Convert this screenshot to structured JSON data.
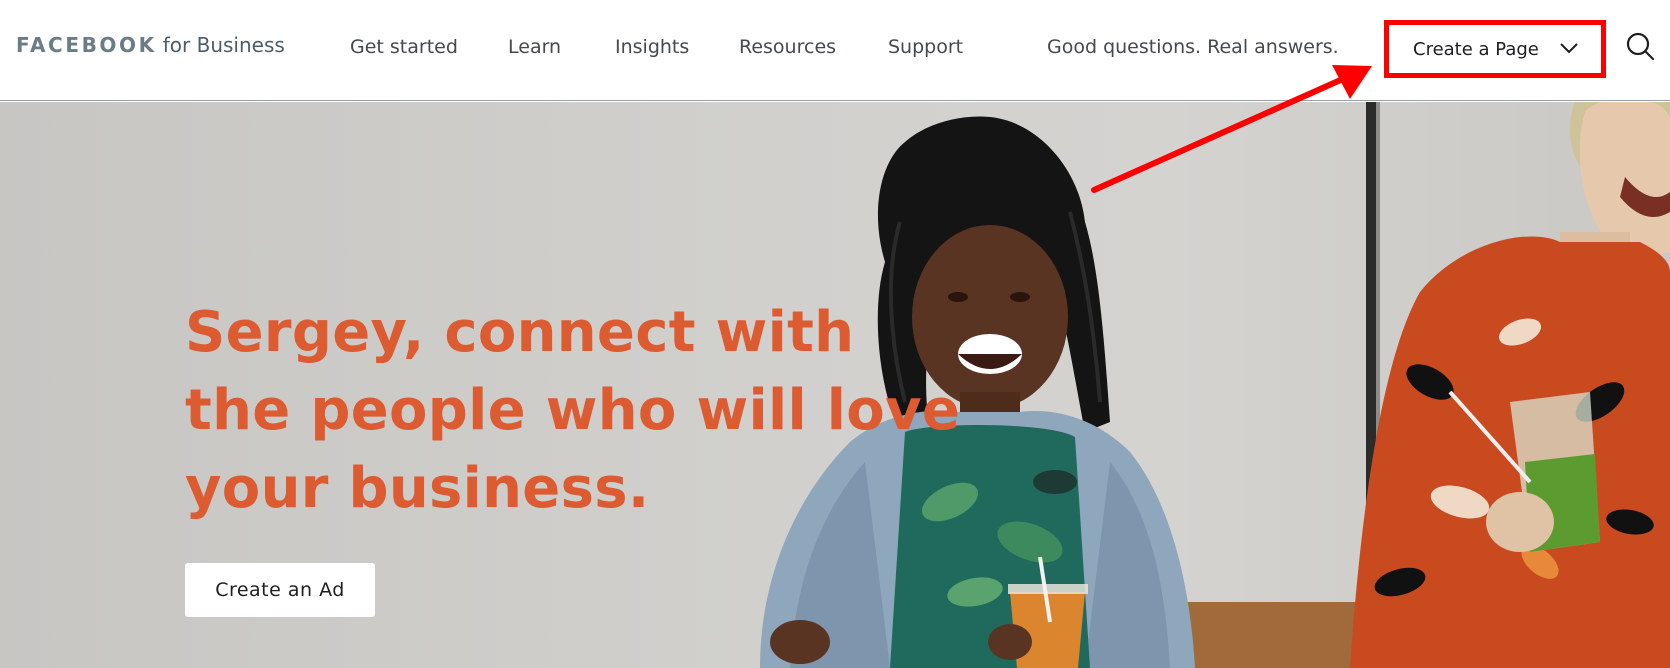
{
  "header": {
    "logo": {
      "word": "FACEBOOK",
      "suffix": "for Business"
    },
    "nav": [
      {
        "label": "Get started"
      },
      {
        "label": "Learn"
      },
      {
        "label": "Insights"
      },
      {
        "label": "Resources"
      },
      {
        "label": "Support"
      }
    ],
    "tagline": "Good questions. Real answers.",
    "create_page": {
      "label": "Create a Page",
      "icon": "chevron-down-icon"
    },
    "search": {
      "icon": "search-icon"
    }
  },
  "hero": {
    "headline_lines": [
      "Sergey, connect with",
      "the people who will love",
      "your business."
    ],
    "cta_label": "Create an Ad",
    "headline_color": "#dc5b31"
  },
  "annotation": {
    "highlight_color": "#ff0000",
    "target": "create-page-button"
  }
}
